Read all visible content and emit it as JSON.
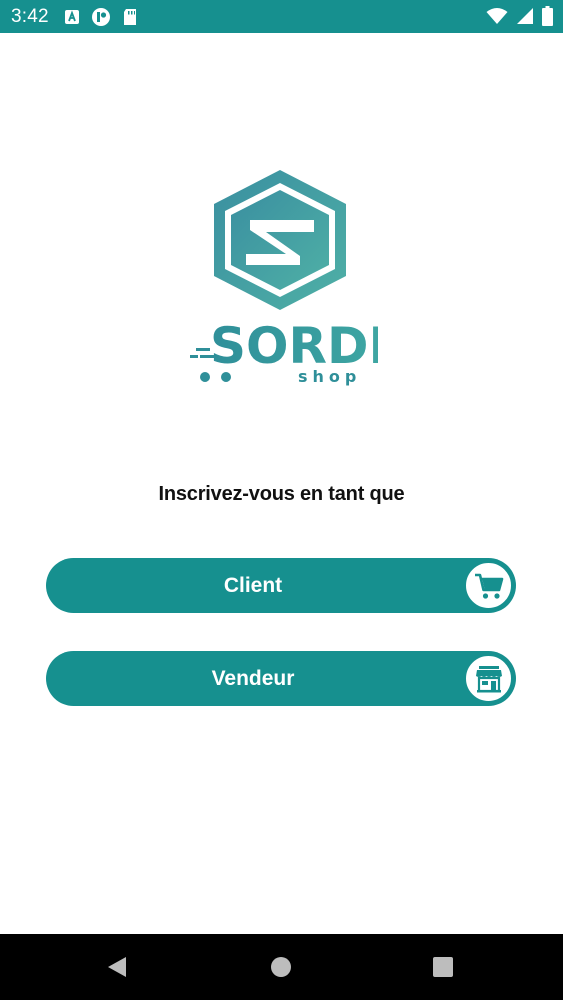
{
  "status_bar": {
    "time": "3:42",
    "left_icons": [
      "text-a-icon",
      "notification-app-icon",
      "sd-card-icon"
    ],
    "right_icons": [
      "wifi-icon",
      "cell-signal-icon",
      "battery-icon"
    ]
  },
  "logo": {
    "brand": "SORDI",
    "tagline": "shop"
  },
  "heading": "Inscrivez-vous en tant que",
  "buttons": {
    "client": {
      "label": "Client",
      "icon": "shopping-cart-icon"
    },
    "vendor": {
      "label": "Vendeur",
      "icon": "storefront-icon"
    }
  },
  "navigation": [
    "back-icon",
    "home-icon",
    "recents-icon"
  ],
  "colors": {
    "accent": "#16908f",
    "nav_bar": "#000000",
    "background": "#ffffff"
  }
}
